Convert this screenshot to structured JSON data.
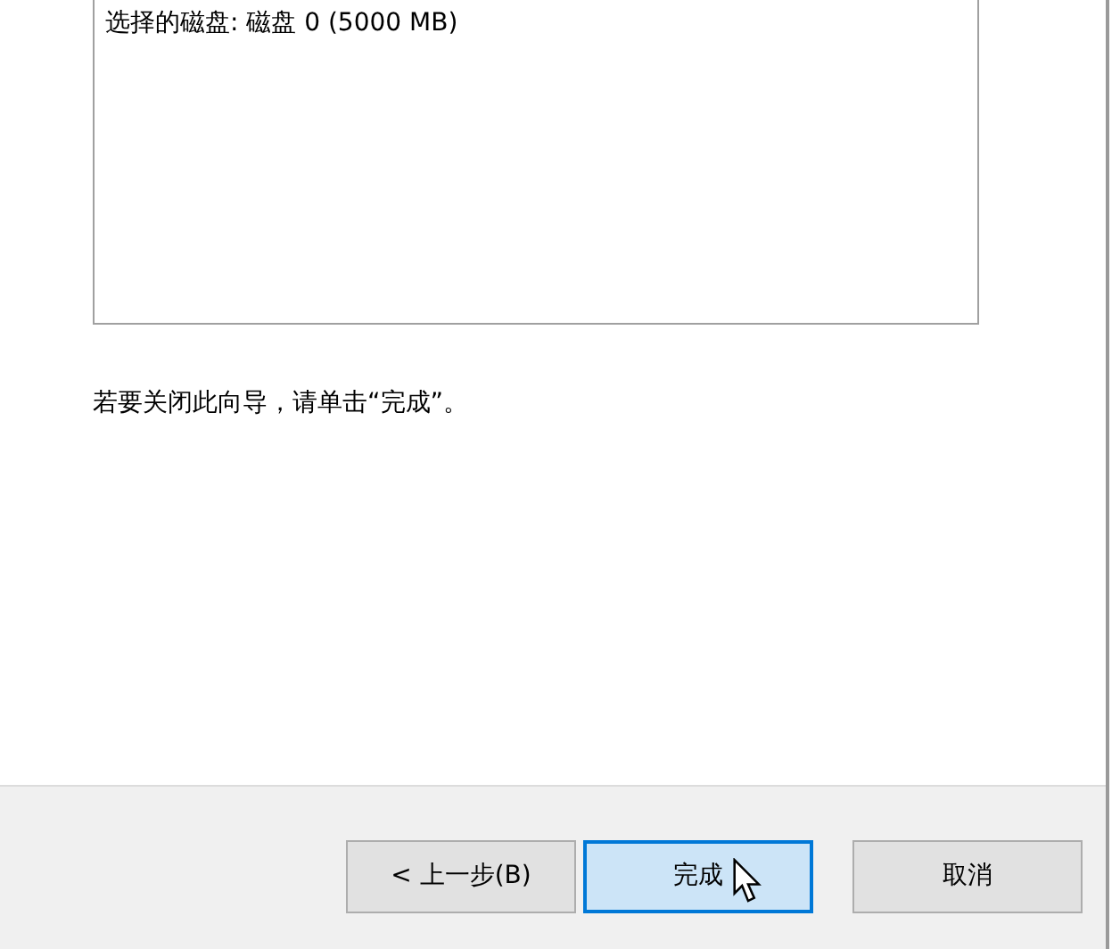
{
  "summary_box": {
    "text": "选择的磁盘: 磁盘 0 (5000 MB)"
  },
  "instruction": "若要关闭此向导，请单击“完成”。",
  "buttons": [
    {
      "label": "< 上一步(B)",
      "focused": false,
      "hovered": false
    },
    {
      "label": "完成",
      "focused": true,
      "hovered": true
    },
    {
      "label": "取消",
      "focused": false,
      "hovered": false
    }
  ]
}
